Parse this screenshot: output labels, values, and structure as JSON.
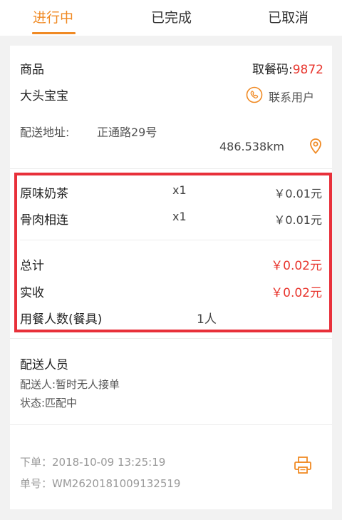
{
  "tabs": [
    {
      "label": "进行中"
    },
    {
      "label": "已完成"
    },
    {
      "label": "已取消"
    }
  ],
  "order": {
    "goods_label": "商品",
    "pickup_code_label": "取餐码:",
    "pickup_code": "9872",
    "customer_name": "大头宝宝",
    "contact_button": "联系用户",
    "address_label": "配送地址:",
    "address": "正通路29号",
    "distance": "486.538km"
  },
  "items": [
    {
      "name": "原味奶茶",
      "qty": "x1",
      "price": "￥0.01元"
    },
    {
      "name": "骨肉相连",
      "qty": "x1",
      "price": "￥0.01元"
    }
  ],
  "totals": {
    "total_label": "总计",
    "total_value": "￥0.02元",
    "received_label": "实收",
    "received_value": "￥0.02元",
    "diners_label": "用餐人数(餐具)",
    "diners_value": "1人"
  },
  "delivery": {
    "section_title": "配送人员",
    "courier_line": "配送人:暂时无人接单",
    "status_line": "状态:匹配中"
  },
  "meta": {
    "order_time": "下单：2018-10-09 13:25:19",
    "order_no": "单号：WM2620181009132519"
  },
  "colors": {
    "accent": "#f08a24",
    "price_red": "#e8362e",
    "highlight_box": "#e8303a"
  }
}
